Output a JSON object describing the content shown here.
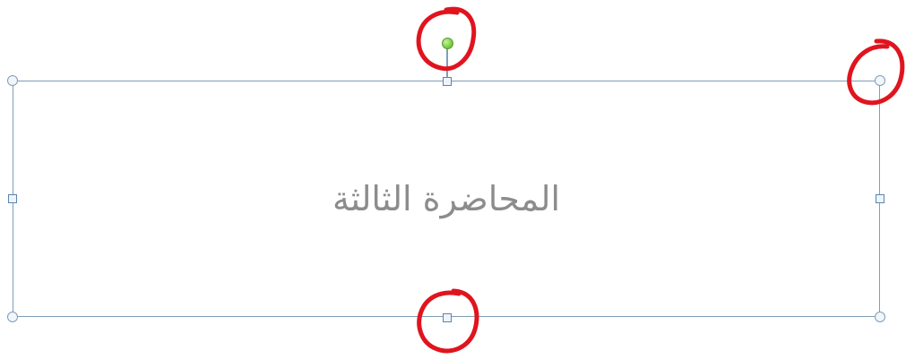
{
  "textbox": {
    "placeholder": "المحاضرة الثالثة"
  },
  "colors": {
    "border": "#7f9db9",
    "rotation_handle": "#7fd04a",
    "annotation_marks": "#e0141e",
    "placeholder_text": "#8c8c8c"
  },
  "annotations": {
    "highlighted_handles": [
      "rotation-handle",
      "top-right-resize-handle",
      "bottom-middle-resize-handle"
    ]
  }
}
